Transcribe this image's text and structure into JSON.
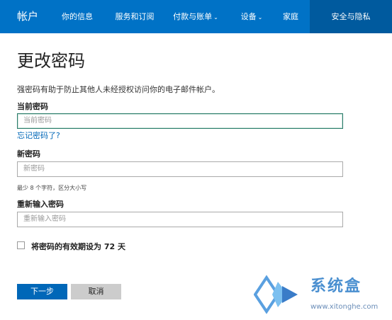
{
  "nav": {
    "brand": "帐户",
    "items": [
      {
        "label": "你的信息",
        "dropdown": false,
        "active": false
      },
      {
        "label": "服务和订阅",
        "dropdown": false,
        "active": false
      },
      {
        "label": "付款与账单",
        "dropdown": true,
        "active": false
      },
      {
        "label": "设备",
        "dropdown": true,
        "active": false
      },
      {
        "label": "家庭",
        "dropdown": false,
        "active": false
      },
      {
        "label": "安全与隐私",
        "dropdown": false,
        "active": true
      }
    ],
    "chevron": "⌄"
  },
  "page": {
    "title": "更改密码",
    "description": "强密码有助于防止其他人未经授权访问你的电子邮件帐户。"
  },
  "current_password": {
    "label": "当前密码",
    "placeholder": "当前密码",
    "forgot_link": "忘记密码了?"
  },
  "new_password": {
    "label": "新密码",
    "placeholder": "新密码",
    "hint": "最少 8 个字符，区分大小写"
  },
  "confirm_password": {
    "label": "重新输入密码",
    "placeholder": "重新输入密码"
  },
  "expire_option": {
    "label": "将密码的有效期设为 72 天",
    "checked": false
  },
  "buttons": {
    "next": "下一步",
    "cancel": "取消"
  },
  "watermark": {
    "text": "系统盒",
    "url": "www.xitonghe.com"
  },
  "colors": {
    "nav_bg": "#0072c6",
    "nav_active_bg": "#005a9e",
    "primary": "#0067b8",
    "focus_border": "#2d7d6c"
  }
}
